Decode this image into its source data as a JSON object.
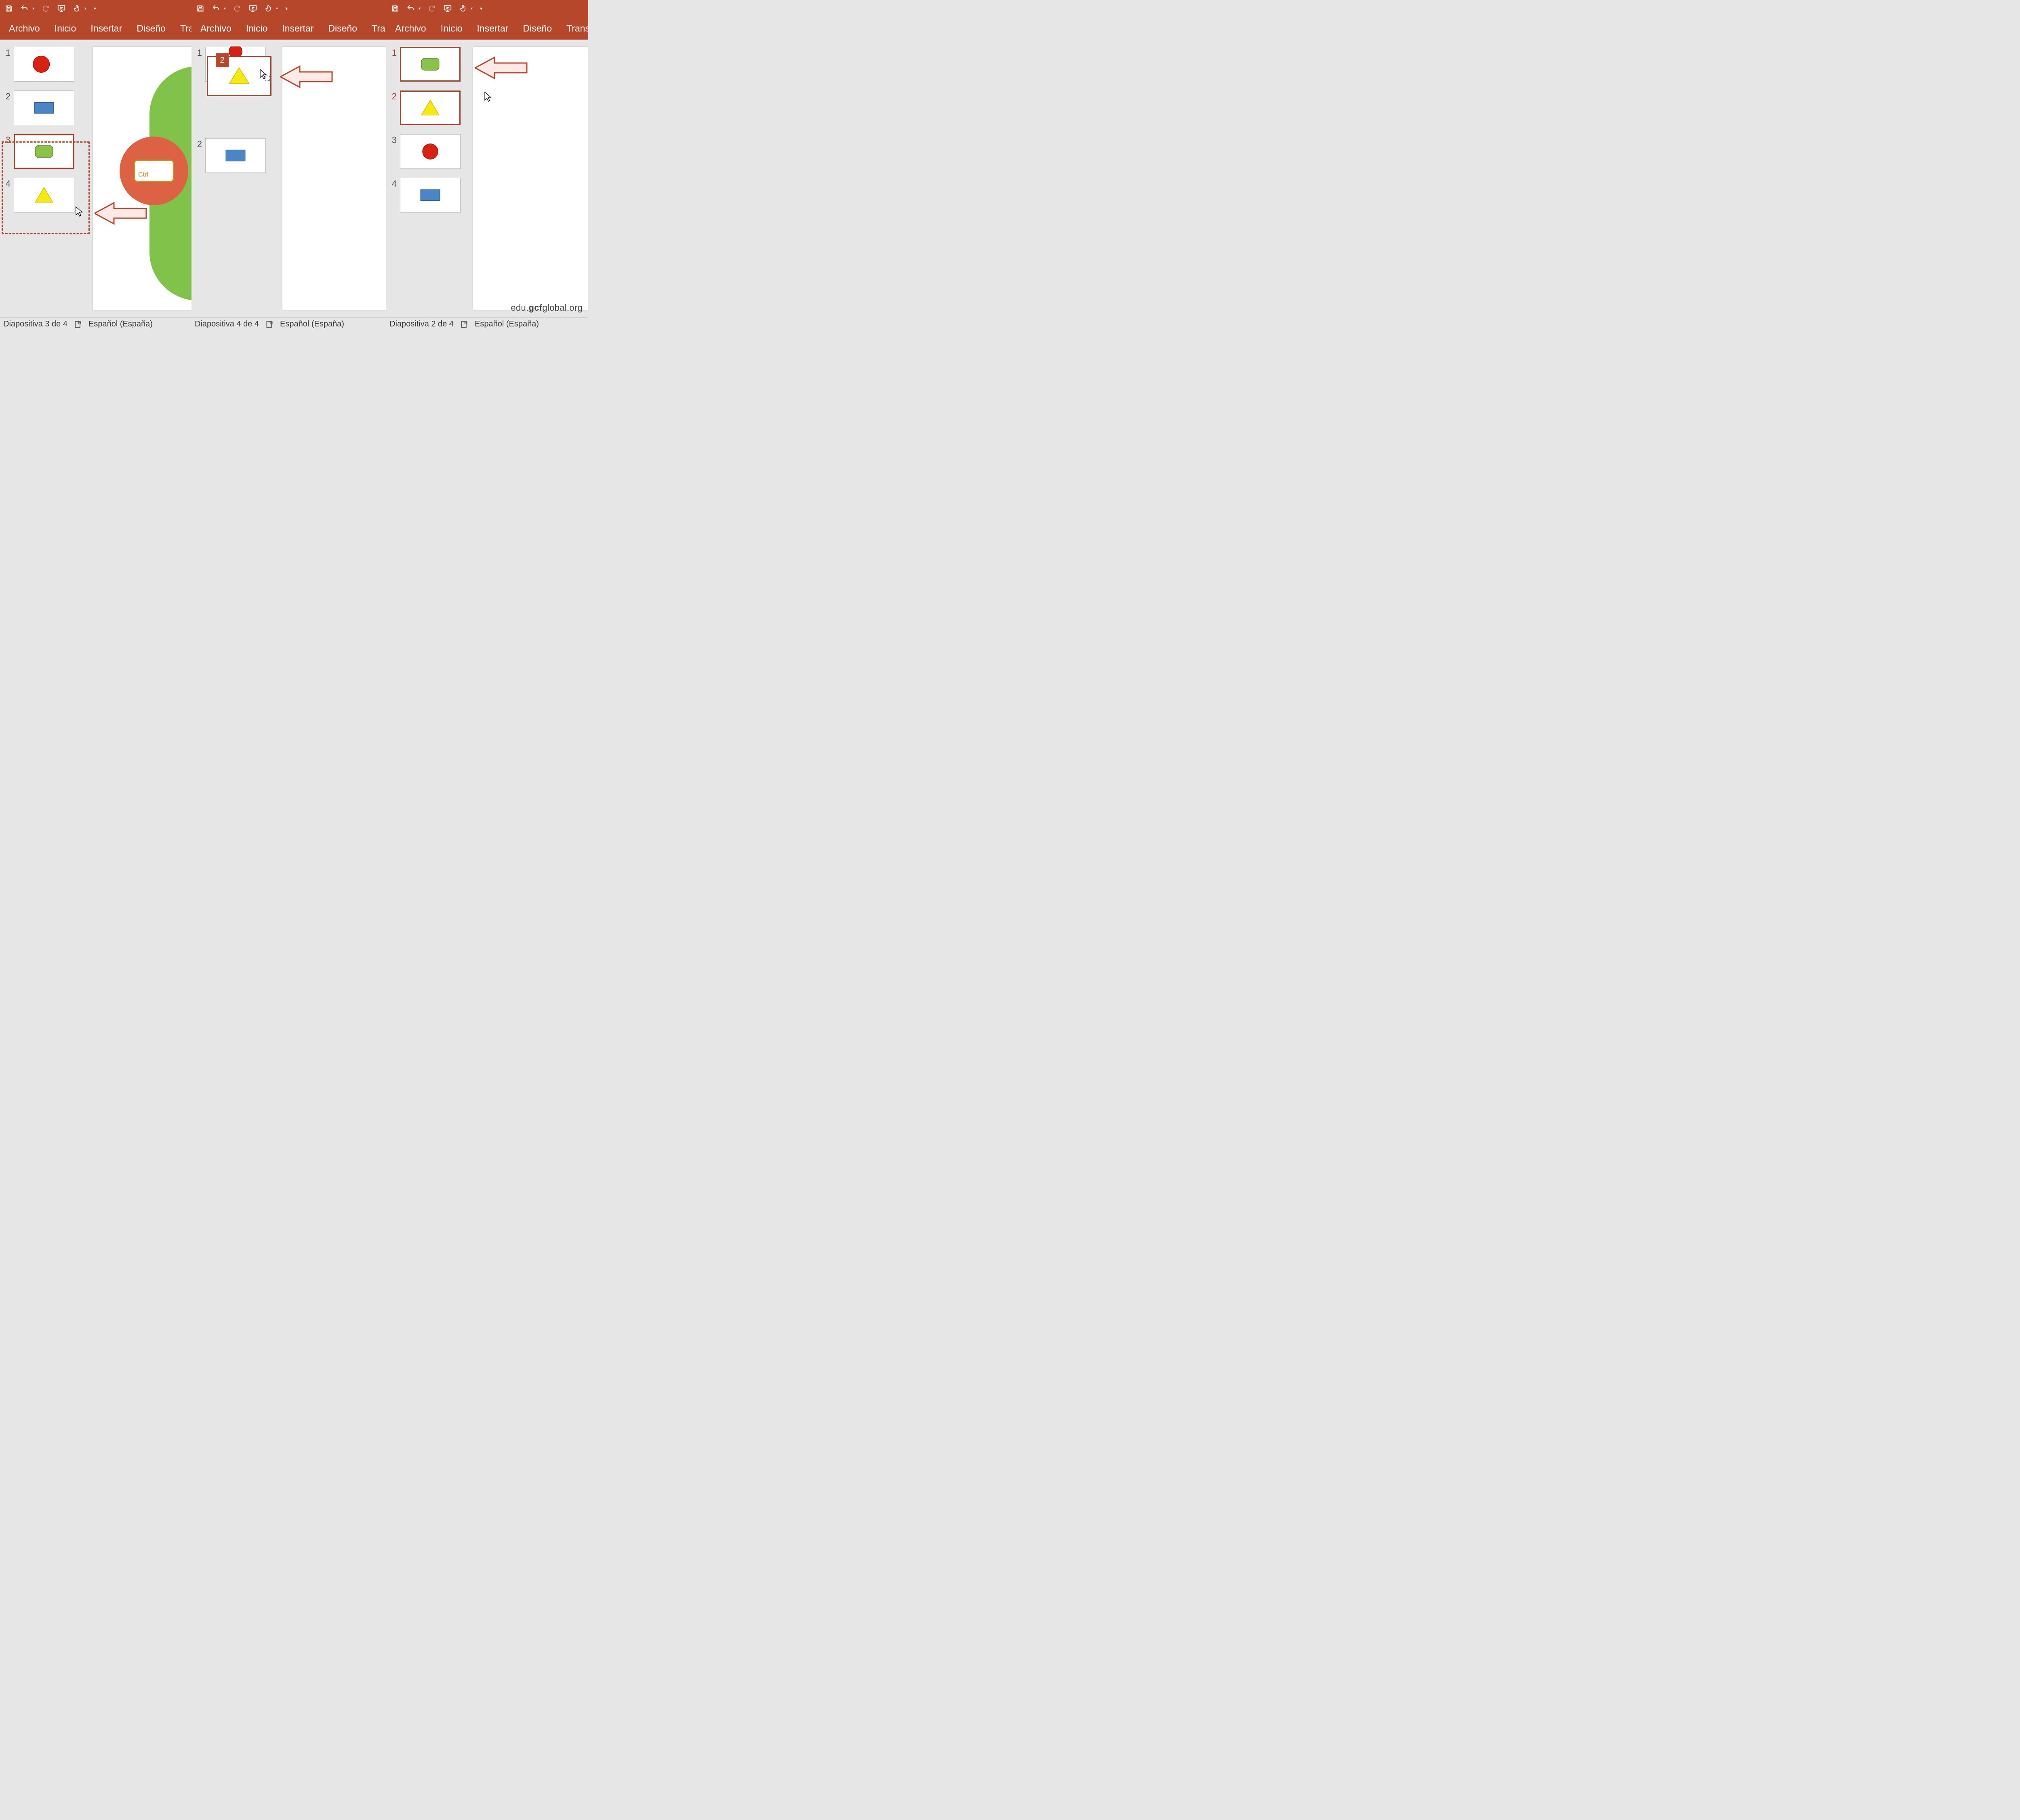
{
  "app": {
    "tabs": {
      "file": "Archivo",
      "home": "Inicio",
      "insert": "Insertar",
      "design": "Diseño",
      "trans_trunc": "Transicio",
      "trans_trunc2": "Transicion",
      "trans_full": "Transiciones"
    }
  },
  "status": {
    "p1": "Diapositiva 3 de 4",
    "p2": "Diapositiva 4 de 4",
    "p3": "Diapositiva 2 de 4",
    "lang": "Español (España)"
  },
  "panel2": {
    "drag_count": "2"
  },
  "ctrl": {
    "label": "Ctrl"
  },
  "watermark": {
    "prefix": "edu.",
    "bold": "gcf",
    "suffix": "global.org"
  },
  "slides": {
    "p1": [
      "1",
      "2",
      "3",
      "4"
    ],
    "p2": [
      "1",
      "2"
    ],
    "p3": [
      "1",
      "2",
      "3",
      "4"
    ]
  }
}
